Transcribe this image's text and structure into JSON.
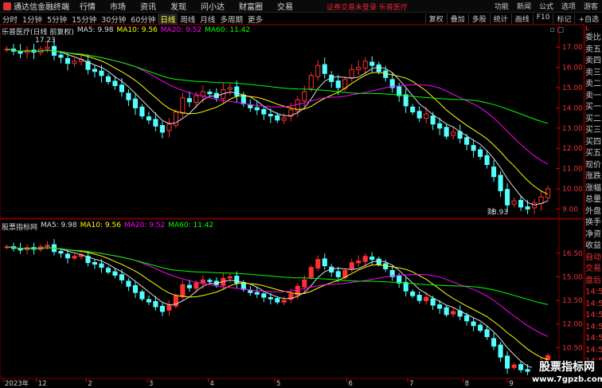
{
  "menubar": {
    "app_name": "通达信金融终端",
    "menu": [
      "行情",
      "市场",
      "资讯",
      "发现",
      "问小达",
      "财富圈",
      "交易"
    ],
    "notice": "证券交易未登录  乐普医疗",
    "right": [
      "功能",
      "新闻",
      "公式",
      "选项",
      "游客"
    ]
  },
  "toolbar": {
    "periods": [
      "分时",
      "1分钟",
      "5分钟",
      "15分钟",
      "30分钟",
      "60分钟",
      "日线",
      "周线",
      "月线",
      "多周期",
      "更多"
    ],
    "active_period": "日线",
    "tools": [
      "复权",
      "叠加",
      "多股",
      "统计",
      "画线",
      "F10",
      "标记",
      "+自选"
    ]
  },
  "main_legend": {
    "name": "乐普医疗(日线 前复权)",
    "ma5": "MA5: 9.98",
    "ma10": "MA10: 9.56",
    "ma20": "MA20: 9.52",
    "ma60": "MA60: 11.42"
  },
  "sub_legend": {
    "name": "股票指标网",
    "ma5": "MA5: 9.98",
    "ma10": "MA10: 9.56",
    "ma20": "MA20: 9.52",
    "ma60": "MA60: 11.42"
  },
  "annotations": {
    "high": "17.23",
    "low": "8.93",
    "cai": "财"
  },
  "main_axis": [
    "17.00",
    "16.00",
    "15.00",
    "14.00",
    "13.00",
    "12.00",
    "11.00",
    "10.00",
    "9.00"
  ],
  "sub_axis": [
    "16.50",
    "15.00",
    "13.50",
    "12.00",
    "10.50"
  ],
  "date_axis": [
    "2023年",
    "12",
    "2",
    "3",
    "4",
    "5",
    "6",
    "7",
    "8",
    "9"
  ],
  "side_panel": {
    "header": "L",
    "items": [
      "委比",
      "卖五",
      "卖四",
      "卖三",
      "卖二",
      "卖一",
      "买一",
      "买二",
      "买三",
      "买四",
      "买五",
      "现价",
      "涨跌",
      "涨幅",
      "总量",
      "外盘",
      "换手",
      "净资",
      "收益",
      "自动",
      "交易",
      "盘后",
      "14:5",
      "14:5",
      "14:5",
      "14:5",
      "14:5",
      "14:5",
      "14:5"
    ]
  },
  "watermark": {
    "title": "股票指标网",
    "url": "www.7gpzb.com"
  },
  "colors": {
    "up": "#ff3030",
    "down": "#54ffff",
    "ma5": "#dddddd",
    "ma10": "#ffff00",
    "ma20": "#ff00ff",
    "ma60": "#00ff00",
    "grid": "#7a0000"
  },
  "chart_data": {
    "type": "candlestick",
    "start_price": 16.9,
    "closes": [
      16.9,
      16.8,
      16.7,
      16.85,
      16.75,
      16.9,
      17.0,
      16.6,
      16.5,
      16.2,
      16.3,
      16.4,
      15.9,
      15.8,
      15.6,
      15.3,
      15.1,
      14.8,
      14.4,
      14.0,
      13.6,
      13.4,
      13.1,
      12.8,
      13.2,
      13.8,
      14.5,
      14.3,
      14.6,
      14.8,
      14.7,
      14.5,
      14.9,
      15.0,
      14.6,
      14.2,
      14.0,
      13.9,
      13.7,
      13.6,
      13.4,
      13.5,
      13.9,
      14.4,
      14.8,
      15.6,
      16.1,
      15.7,
      15.3,
      15.0,
      15.4,
      15.9,
      16.0,
      16.3,
      16.1,
      15.8,
      15.5,
      15.0,
      14.6,
      14.1,
      13.8,
      13.5,
      13.7,
      13.2,
      13.0,
      12.6,
      12.8,
      12.5,
      12.2,
      11.9,
      11.6,
      11.2,
      10.6,
      9.9,
      9.2,
      9.4,
      9.1,
      9.0,
      9.3,
      9.6,
      10.0
    ],
    "ylim": [
      8.7,
      17.6
    ]
  }
}
